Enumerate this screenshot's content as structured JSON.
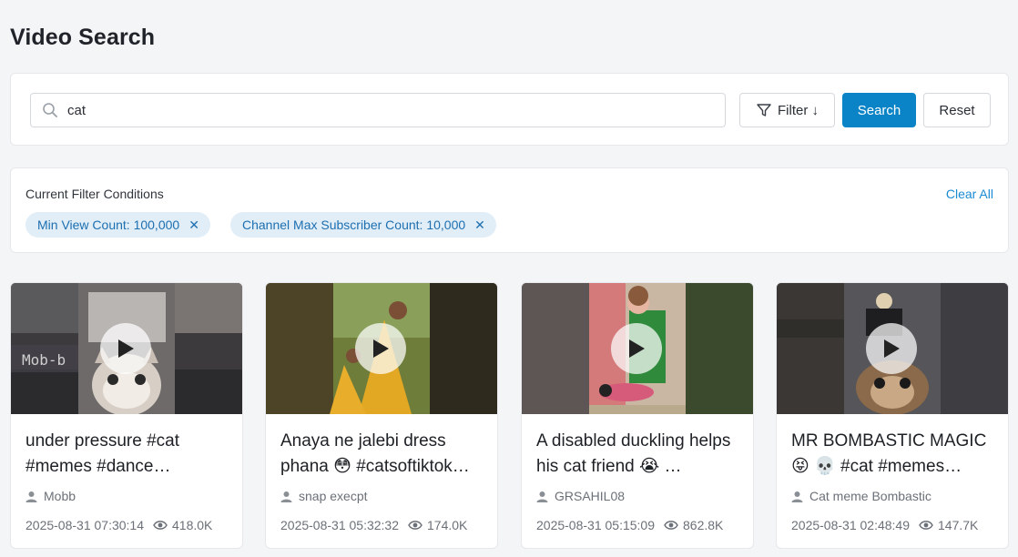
{
  "page": {
    "title": "Video Search"
  },
  "search": {
    "query": "cat",
    "filter_label": "Filter ↓",
    "search_label": "Search",
    "reset_label": "Reset",
    "accent_color": "#0a84c6"
  },
  "filters": {
    "heading": "Current Filter Conditions",
    "clear_all": "Clear All",
    "chips": [
      {
        "label": "Min View Count:",
        "value": "100,000"
      },
      {
        "label": "Channel Max Subscriber Count:",
        "value": "10,000"
      }
    ]
  },
  "videos": [
    {
      "title": "under pressure #cat #memes #dance…",
      "channel": "Mobb",
      "date": "2025-08-31 07:30:14",
      "views": "418.0K"
    },
    {
      "title": "Anaya ne jalebi dress phana 😳 #catsoftiktok…",
      "channel": "snap execpt",
      "date": "2025-08-31 05:32:32",
      "views": "174.0K"
    },
    {
      "title": "A disabled duckling helps his cat friend 😭 …",
      "channel": "GRSAHIL08",
      "date": "2025-08-31 05:15:09",
      "views": "862.8K"
    },
    {
      "title": "MR BOMBASTIC MAGIC 😝 💀 #cat #memes…",
      "channel": "Cat meme Bombastic",
      "date": "2025-08-31 02:48:49",
      "views": "147.7K"
    }
  ]
}
